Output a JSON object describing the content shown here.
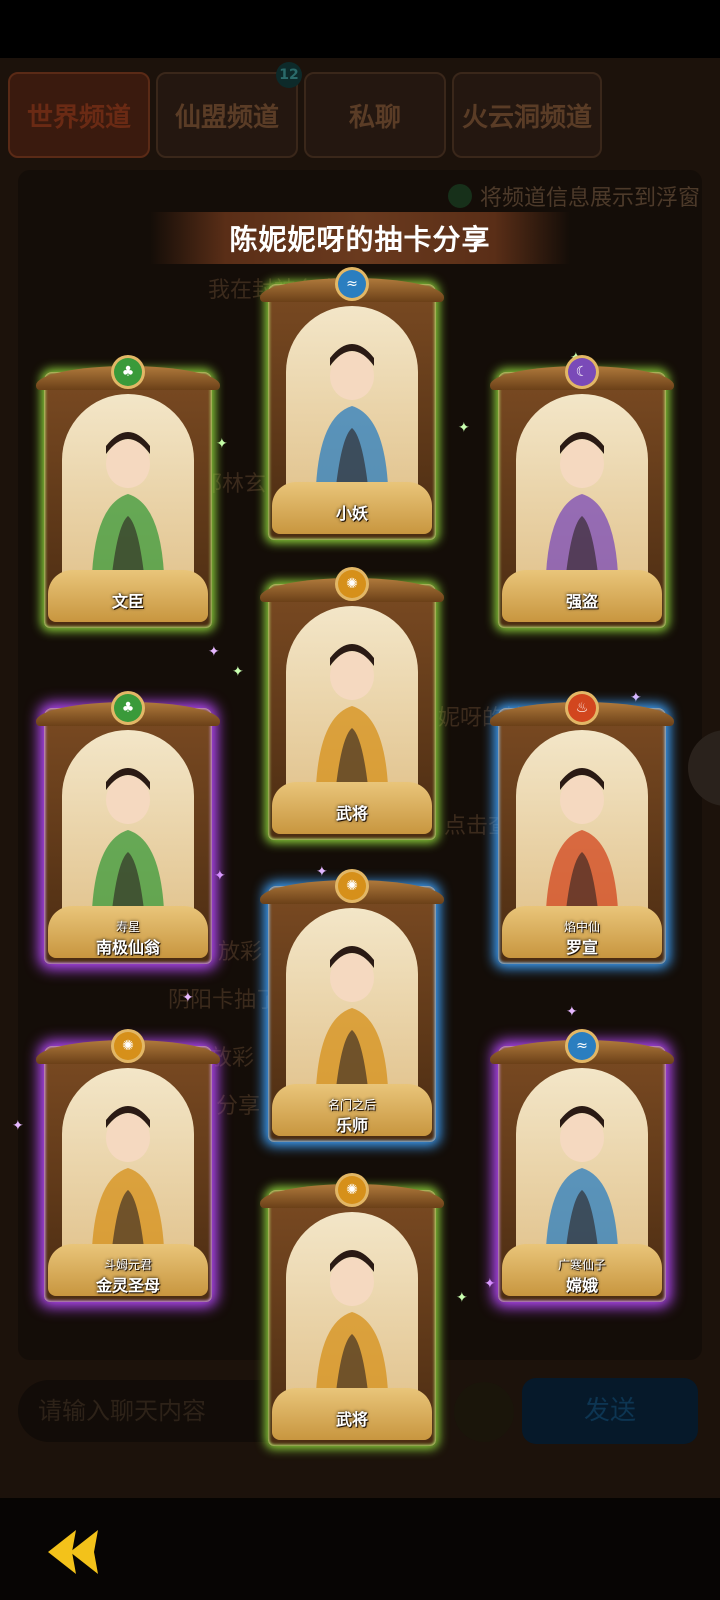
{
  "tabs": [
    {
      "label": "世界频道",
      "active": true
    },
    {
      "label": "仙盟频道",
      "badge": "12"
    },
    {
      "label": "私聊"
    },
    {
      "label": "火云洞频道"
    }
  ],
  "chat": {
    "float_option_label": "将频道信息展示到浮窗",
    "bg_lines": [
      "我在封神台中",
      "邪林玄",
      "妮呀的抽卡分",
      "放彩",
      "阴阳卡抽了",
      "0阴阳放彩",
      "点击查",
      "分享"
    ],
    "input_placeholder": "请输入聊天内容",
    "send_label": "发送"
  },
  "share": {
    "title": "陈妮妮呀的抽卡分享",
    "cards": [
      {
        "name": "文臣",
        "subtitle": "",
        "element": "wood-icon",
        "rarity": "green",
        "emblem_color": "#3a9a3a"
      },
      {
        "name": "小妖",
        "subtitle": "",
        "element": "water-icon",
        "rarity": "green",
        "emblem_color": "#2a7ec0"
      },
      {
        "name": "强盗",
        "subtitle": "",
        "element": "moon-icon",
        "rarity": "green",
        "emblem_color": "#7a4ab8"
      },
      {
        "name": "武将",
        "subtitle": "",
        "element": "sun-icon",
        "rarity": "green",
        "emblem_color": "#d6901a"
      },
      {
        "name": "南极仙翁",
        "subtitle": "寿星",
        "element": "wood-icon",
        "rarity": "purple",
        "emblem_color": "#3a9a3a"
      },
      {
        "name": "罗宣",
        "subtitle": "焰中仙",
        "element": "fire-icon",
        "rarity": "blue",
        "emblem_color": "#d2461e"
      },
      {
        "name": "乐师",
        "subtitle": "名门之后",
        "element": "sun-icon",
        "rarity": "blue",
        "emblem_color": "#d6901a"
      },
      {
        "name": "金灵圣母",
        "subtitle": "斗姆元君",
        "element": "sun-icon",
        "rarity": "purple",
        "emblem_color": "#d6901a"
      },
      {
        "name": "嫦娥",
        "subtitle": "广寒仙子",
        "element": "water-icon",
        "rarity": "purple",
        "emblem_color": "#2a7ec0"
      },
      {
        "name": "武将",
        "subtitle": "",
        "element": "sun-icon",
        "rarity": "green",
        "emblem_color": "#d6901a"
      }
    ]
  },
  "nav": {
    "back_icon": "back-arrow-icon"
  }
}
